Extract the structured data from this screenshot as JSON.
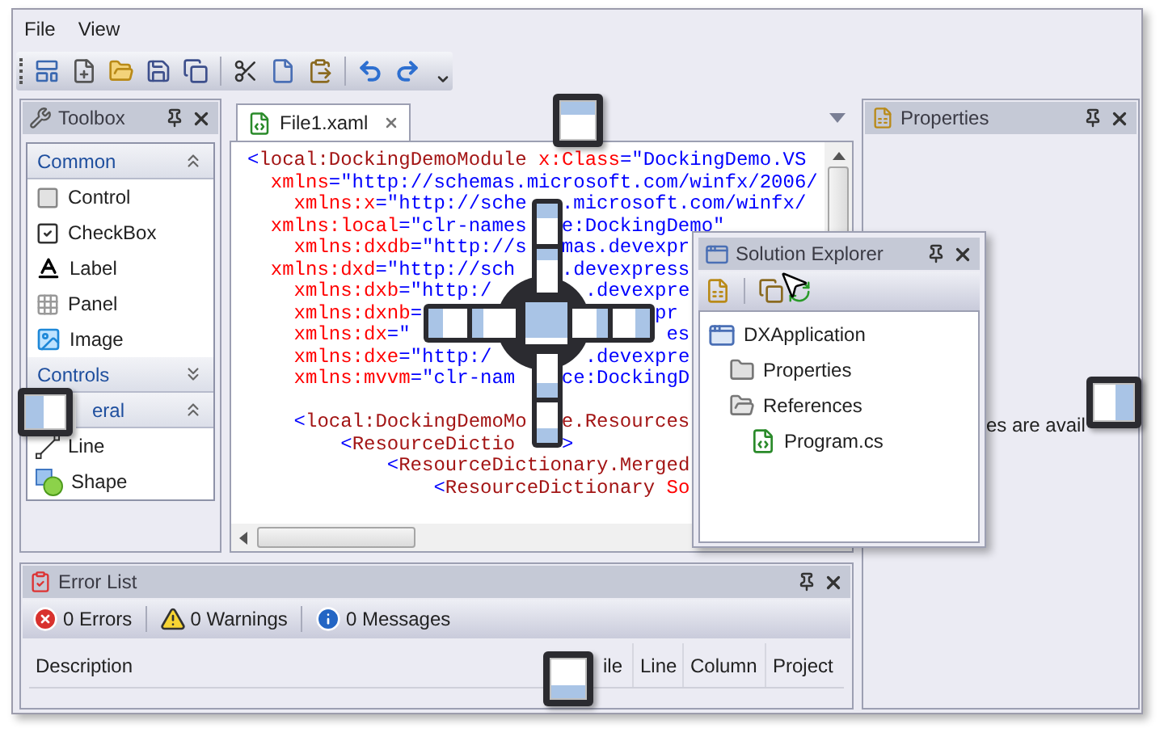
{
  "menu": [
    {
      "label": "File"
    },
    {
      "label": "View"
    }
  ],
  "toolbox": {
    "title": "Toolbox",
    "groups": [
      {
        "label": "Common",
        "expanded": true,
        "items": [
          {
            "label": "Control",
            "kind": "control"
          },
          {
            "label": "CheckBox",
            "kind": "checkbox"
          },
          {
            "label": "Label",
            "kind": "label"
          },
          {
            "label": "Panel",
            "kind": "panel"
          },
          {
            "label": "Image",
            "kind": "image"
          }
        ]
      },
      {
        "label": "Controls",
        "expanded": false
      },
      {
        "label": "eral",
        "expanded": true,
        "items": [
          {
            "label": "Line",
            "kind": "line"
          },
          {
            "label": "Shape",
            "kind": "shape"
          }
        ]
      }
    ]
  },
  "editor": {
    "tabs": [
      {
        "label": "File1.xaml",
        "selected": true
      }
    ],
    "lines": [
      {
        "fragments": [
          [
            {
              "text": "<",
              "kind": "value"
            },
            {
              "text": "local:DockingDemoModule",
              "kind": "tag"
            },
            {
              "text": " x:Class",
              "kind": "attr"
            },
            {
              "text": "=\"DockingDemo.VS",
              "kind": "value"
            }
          ]
        ]
      },
      {
        "fragments": [
          [
            {
              "text": "xmlns",
              "kind": "attr"
            },
            {
              "text": "=\"http://schemas.microsoft.com/winfx/2006/",
              "kind": "value"
            }
          ]
        ]
      },
      {
        "fragments": [
          [
            {
              "text": "xmlns:x",
              "kind": "attr"
            },
            {
              "text": "=\"http://sche",
              "kind": "value"
            }
          ],
          [
            {
              "text": ".microsoft.com/winfx/",
              "kind": "value"
            }
          ]
        ]
      },
      {
        "fragments": [
          [
            {
              "text": "xmlns:local",
              "kind": "attr"
            },
            {
              "text": "=\"clr-names",
              "kind": "value"
            }
          ],
          [
            {
              "text": "e:DockingDemo\"",
              "kind": "value"
            }
          ]
        ]
      },
      {
        "fragments": [
          [
            {
              "text": "xmlns:dxdb",
              "kind": "attr"
            },
            {
              "text": "=\"http://s",
              "kind": "value"
            }
          ],
          [
            {
              "text": "mas.devexpr",
              "kind": "value"
            }
          ]
        ]
      },
      {
        "fragments": [
          [
            {
              "text": "xmlns:dxd",
              "kind": "attr"
            },
            {
              "text": "=\"http://sch",
              "kind": "value"
            }
          ],
          [
            {
              "text": ".devexpress",
              "kind": "value"
            }
          ]
        ]
      },
      {
        "fragments": [
          [
            {
              "text": "xmlns:dxb",
              "kind": "attr"
            },
            {
              "text": "=\"http:/",
              "kind": "value"
            }
          ],
          [
            {
              "text": ".devexpre",
              "kind": "value"
            }
          ]
        ]
      },
      {
        "fragments": [
          [
            {
              "text": "xmlns:dxnb",
              "kind": "attr"
            },
            {
              "text": "=",
              "kind": "value"
            }
          ],
          [
            {
              "text": "pr",
              "kind": "value"
            }
          ]
        ]
      },
      {
        "fragments": [
          [
            {
              "text": "xmlns:dx",
              "kind": "attr"
            },
            {
              "text": "=\"",
              "kind": "value"
            }
          ],
          [
            {
              "text": "es",
              "kind": "value"
            }
          ]
        ]
      },
      {
        "fragments": [
          [
            {
              "text": "xmlns:dxe",
              "kind": "attr"
            },
            {
              "text": "=\"http:/",
              "kind": "value"
            }
          ],
          [
            {
              "text": ".devexpre",
              "kind": "value"
            }
          ]
        ]
      },
      {
        "fragments": [
          [
            {
              "text": "xmlns:mvvm",
              "kind": "attr"
            },
            {
              "text": "=\"clr-nam",
              "kind": "value"
            }
          ],
          [
            {
              "text": "ce:DockingD",
              "kind": "value"
            }
          ]
        ]
      },
      {
        "fragments": [
          [
            {
              "text": "<",
              "kind": "value"
            },
            {
              "text": "local:DockingDemoMo",
              "kind": "tag"
            }
          ],
          [
            {
              "text": "e.Resources",
              "kind": "tag"
            }
          ]
        ]
      },
      {
        "fragments": [
          [
            {
              "text": "<",
              "kind": "value"
            },
            {
              "text": "ResourceDictio",
              "kind": "tag"
            }
          ],
          [
            {
              "text": ">",
              "kind": "value"
            }
          ]
        ]
      },
      {
        "fragments": [
          [
            {
              "text": "<",
              "kind": "value"
            },
            {
              "text": "ResourceDictionary.Merged",
              "kind": "tag"
            }
          ]
        ]
      },
      {
        "fragments": [
          [
            {
              "text": "<",
              "kind": "value"
            },
            {
              "text": "ResourceDictionary",
              "kind": "tag"
            },
            {
              "text": " So",
              "kind": "attr"
            }
          ]
        ]
      }
    ]
  },
  "properties": {
    "title": "Properties",
    "message": "es are avail"
  },
  "solution_explorer": {
    "title": "Solution Explorer",
    "tree": [
      {
        "label": "DXApplication",
        "kind": "project",
        "children": [
          {
            "label": "Properties",
            "kind": "properties-folder"
          },
          {
            "label": "References",
            "kind": "folder",
            "children": [
              {
                "label": "Program.cs",
                "kind": "csharp"
              }
            ]
          }
        ]
      }
    ]
  },
  "error_list": {
    "title": "Error List",
    "filters": [
      {
        "label": "0 Errors",
        "kind": "error"
      },
      {
        "label": "0 Warnings",
        "kind": "warning"
      },
      {
        "label": "0 Messages",
        "kind": "info"
      }
    ],
    "columns": [
      "Description",
      "ile",
      "Line",
      "Column",
      "Project"
    ]
  }
}
